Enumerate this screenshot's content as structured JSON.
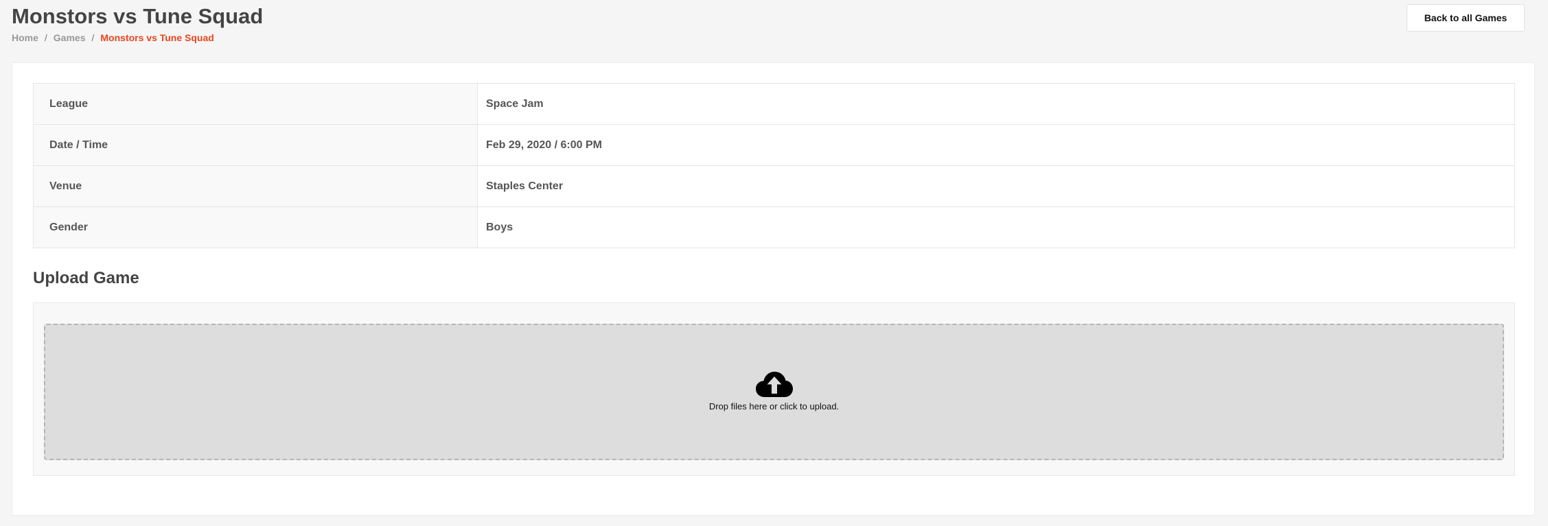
{
  "header": {
    "title": "Monstors vs Tune Squad",
    "back_button": "Back to all Games"
  },
  "breadcrumb": {
    "items": [
      "Home",
      "Games"
    ],
    "separator": "/",
    "current": "Monstors vs Tune Squad"
  },
  "details": {
    "rows": [
      {
        "label": "League",
        "value": "Space Jam"
      },
      {
        "label": "Date / Time",
        "value": "Feb 29, 2020 / 6:00 PM"
      },
      {
        "label": "Venue",
        "value": "Staples Center"
      },
      {
        "label": "Gender",
        "value": "Boys"
      }
    ]
  },
  "upload": {
    "title": "Upload Game",
    "message": "Drop files here or click to upload.",
    "icon": "cloud-upload-icon"
  },
  "colors": {
    "accent": "#e8461e",
    "background": "#f5f5f5",
    "dropzone": "#dddddd"
  }
}
